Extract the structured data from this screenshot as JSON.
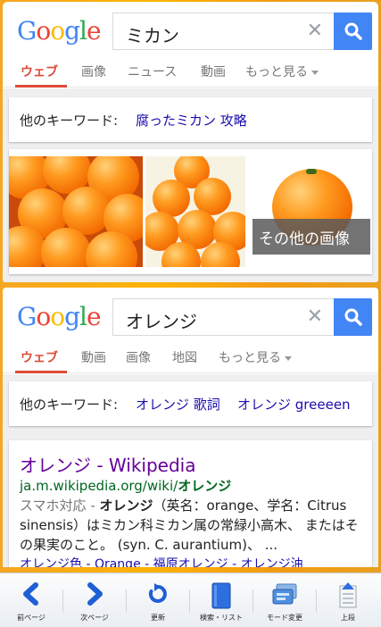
{
  "panel1": {
    "logo": [
      "G",
      "o",
      "o",
      "g",
      "l",
      "e"
    ],
    "query": "ミカン",
    "tabs": [
      "ウェブ",
      "画像",
      "ニュース",
      "動画",
      "もっと見る"
    ],
    "keywords_label": "他のキーワード:",
    "keywords": [
      "腐ったミカン 攻略"
    ],
    "more_images": "その他の画像"
  },
  "panel2": {
    "logo": [
      "G",
      "o",
      "o",
      "g",
      "l",
      "e"
    ],
    "query": "オレンジ",
    "tabs": [
      "ウェブ",
      "動画",
      "画像",
      "地図",
      "もっと見る"
    ],
    "keywords_label": "他のキーワード:",
    "keywords": [
      "オレンジ 歌詞",
      "オレンジ greeeen"
    ],
    "result": {
      "title": "オレンジ - Wikipedia",
      "url_prefix": "ja.m.wikipedia.org/wiki/",
      "url_bold": "オレンジ",
      "snippet_grey": "スマホ対応 - ",
      "snippet_bold": "オレンジ",
      "snippet_rest": "（英名：orange、学名：Citrus sinensis）はミカン科ミカン属の常緑小高木、 またはその果実のこと。 (syn. C. aurantium)、 ...",
      "links": "オレンジ色 - Orange - 福原オレンジ - オレンジ油"
    }
  },
  "toolbar": {
    "items": [
      "前ページ",
      "次ページ",
      "更新",
      "検索・リスト",
      "モード変更",
      "上段"
    ]
  },
  "colors": {
    "google_blue": "#4285f4",
    "google_red": "#ea4335",
    "google_yellow": "#fbbc05",
    "google_green": "#34a853",
    "active_tab": "#dd4b39",
    "link": "#1a0dab",
    "visited": "#660099",
    "url_green": "#006621"
  },
  "icons": [
    "close-icon",
    "search-icon",
    "back-arrow-icon",
    "forward-arrow-icon",
    "refresh-icon",
    "book-icon",
    "mode-icon",
    "upload-icon"
  ]
}
